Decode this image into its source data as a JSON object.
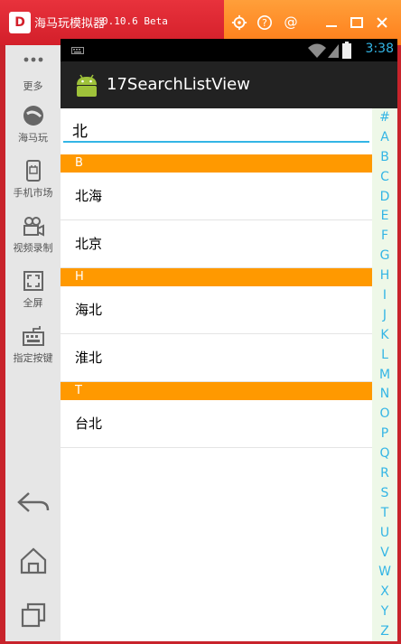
{
  "window": {
    "app_name": "海马玩模拟器",
    "version": "0.10.6 Beta",
    "logo_letter": "D",
    "title_buttons": [
      "settings-icon",
      "help-icon",
      "at-icon",
      "minimize-icon",
      "maximize-icon",
      "close-icon"
    ]
  },
  "sidebar": {
    "items": [
      {
        "label": "更多",
        "icon": "more-dots-icon"
      },
      {
        "label": "海马玩",
        "icon": "haima-logo-icon"
      },
      {
        "label": "手机市场",
        "icon": "market-icon"
      },
      {
        "label": "视频录制",
        "icon": "video-record-icon"
      },
      {
        "label": "全屏",
        "icon": "fullscreen-icon"
      },
      {
        "label": "指定按键",
        "icon": "keyboard-icon"
      }
    ],
    "nav": [
      "back-icon",
      "home-icon",
      "recents-icon"
    ]
  },
  "statusbar": {
    "time": "3:38"
  },
  "actionbar": {
    "title": "17SearchListView"
  },
  "search": {
    "value": "北"
  },
  "list": {
    "sections": [
      {
        "header": "B",
        "items": [
          "北海",
          "北京"
        ]
      },
      {
        "header": "H",
        "items": [
          "海北",
          "淮北"
        ]
      },
      {
        "header": "T",
        "items": [
          "台北"
        ]
      }
    ]
  },
  "index_bar": {
    "letters": [
      "#",
      "A",
      "B",
      "C",
      "D",
      "E",
      "F",
      "G",
      "H",
      "I",
      "J",
      "K",
      "L",
      "M",
      "N",
      "O",
      "P",
      "Q",
      "R",
      "S",
      "T",
      "U",
      "V",
      "W",
      "X",
      "Y",
      "Z"
    ]
  },
  "colors": {
    "accent": "#33b5e5",
    "section": "#ff9900",
    "titlebar": "#d31f2a",
    "titlebar_right": "#ff8c25"
  }
}
